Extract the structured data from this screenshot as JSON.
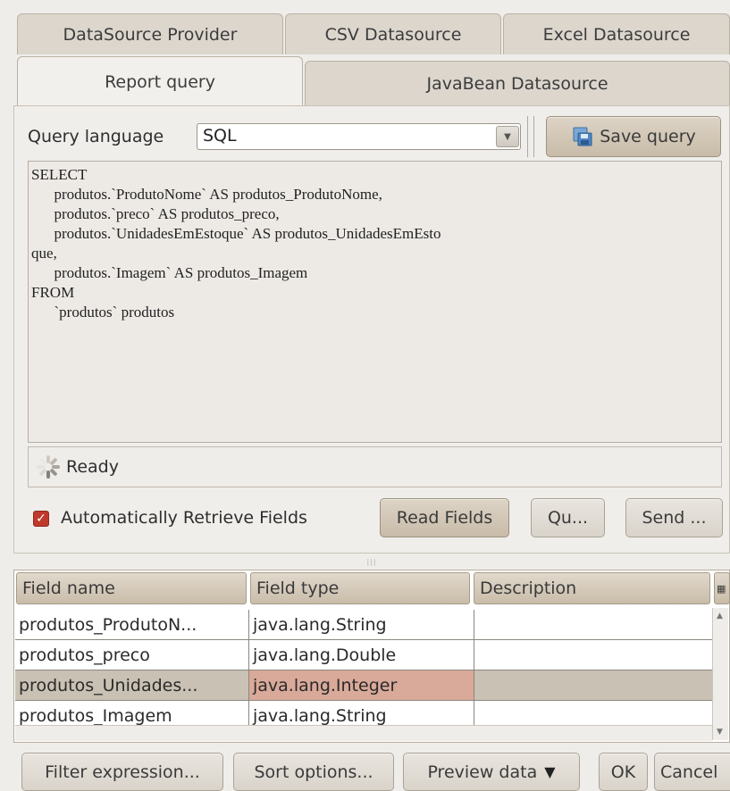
{
  "tabs_row1": [
    {
      "label": "DataSource Provider"
    },
    {
      "label": "CSV Datasource"
    },
    {
      "label": "Excel Datasource"
    }
  ],
  "tabs_row2": [
    {
      "label": "Report query",
      "active": true
    },
    {
      "label": "JavaBean Datasource"
    }
  ],
  "query": {
    "language_label": "Query language",
    "language_value": "SQL",
    "save_label": "Save query",
    "sql_text": "SELECT\n      produtos.`ProdutoNome` AS produtos_ProdutoNome,\n      produtos.`preco` AS produtos_preco,\n      produtos.`UnidadesEmEstoque` AS produtos_UnidadesEmEsto\nque,\n      produtos.`Imagem` AS produtos_Imagem\nFROM\n      `produtos` produtos"
  },
  "status": {
    "text": "Ready"
  },
  "controls": {
    "auto_retrieve_label": "Automatically Retrieve Fields",
    "auto_retrieve_checked": true,
    "read_fields_label": "Read Fields",
    "query_designer_label": "Qu...",
    "send_label": "Send ..."
  },
  "fields_table": {
    "columns": [
      "Field name",
      "Field type",
      "Description"
    ],
    "rows": [
      {
        "name": "produtos_ProdutoN...",
        "type": "java.lang.String",
        "description": ""
      },
      {
        "name": "produtos_preco",
        "type": "java.lang.Double",
        "description": ""
      },
      {
        "name": "produtos_Unidades...",
        "type": "java.lang.Integer",
        "description": "",
        "selected": true
      },
      {
        "name": "produtos_Imagem",
        "type": "java.lang.String",
        "description": ""
      }
    ]
  },
  "footer": {
    "filter_label": "Filter expression...",
    "sort_label": "Sort options...",
    "preview_label": "Preview data",
    "ok_label": "OK",
    "cancel_label": "Cancel"
  },
  "colors": {
    "selected_row": "#c9c1b3",
    "selected_cell": "#d9a999",
    "checkbox_red": "#c0392b"
  }
}
